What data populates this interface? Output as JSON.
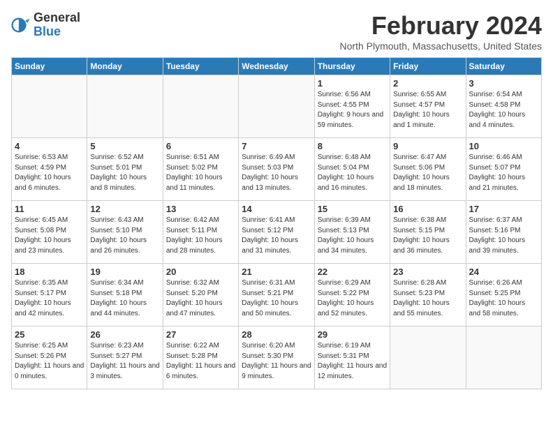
{
  "logo": {
    "line1": "General",
    "line2": "Blue"
  },
  "title": "February 2024",
  "subtitle": "North Plymouth, Massachusetts, United States",
  "days_of_week": [
    "Sunday",
    "Monday",
    "Tuesday",
    "Wednesday",
    "Thursday",
    "Friday",
    "Saturday"
  ],
  "weeks": [
    [
      {
        "day": "",
        "info": ""
      },
      {
        "day": "",
        "info": ""
      },
      {
        "day": "",
        "info": ""
      },
      {
        "day": "",
        "info": ""
      },
      {
        "day": "1",
        "info": "Sunrise: 6:56 AM\nSunset: 4:55 PM\nDaylight: 9 hours and 59 minutes."
      },
      {
        "day": "2",
        "info": "Sunrise: 6:55 AM\nSunset: 4:57 PM\nDaylight: 10 hours and 1 minute."
      },
      {
        "day": "3",
        "info": "Sunrise: 6:54 AM\nSunset: 4:58 PM\nDaylight: 10 hours and 4 minutes."
      }
    ],
    [
      {
        "day": "4",
        "info": "Sunrise: 6:53 AM\nSunset: 4:59 PM\nDaylight: 10 hours and 6 minutes."
      },
      {
        "day": "5",
        "info": "Sunrise: 6:52 AM\nSunset: 5:01 PM\nDaylight: 10 hours and 8 minutes."
      },
      {
        "day": "6",
        "info": "Sunrise: 6:51 AM\nSunset: 5:02 PM\nDaylight: 10 hours and 11 minutes."
      },
      {
        "day": "7",
        "info": "Sunrise: 6:49 AM\nSunset: 5:03 PM\nDaylight: 10 hours and 13 minutes."
      },
      {
        "day": "8",
        "info": "Sunrise: 6:48 AM\nSunset: 5:04 PM\nDaylight: 10 hours and 16 minutes."
      },
      {
        "day": "9",
        "info": "Sunrise: 6:47 AM\nSunset: 5:06 PM\nDaylight: 10 hours and 18 minutes."
      },
      {
        "day": "10",
        "info": "Sunrise: 6:46 AM\nSunset: 5:07 PM\nDaylight: 10 hours and 21 minutes."
      }
    ],
    [
      {
        "day": "11",
        "info": "Sunrise: 6:45 AM\nSunset: 5:08 PM\nDaylight: 10 hours and 23 minutes."
      },
      {
        "day": "12",
        "info": "Sunrise: 6:43 AM\nSunset: 5:10 PM\nDaylight: 10 hours and 26 minutes."
      },
      {
        "day": "13",
        "info": "Sunrise: 6:42 AM\nSunset: 5:11 PM\nDaylight: 10 hours and 28 minutes."
      },
      {
        "day": "14",
        "info": "Sunrise: 6:41 AM\nSunset: 5:12 PM\nDaylight: 10 hours and 31 minutes."
      },
      {
        "day": "15",
        "info": "Sunrise: 6:39 AM\nSunset: 5:13 PM\nDaylight: 10 hours and 34 minutes."
      },
      {
        "day": "16",
        "info": "Sunrise: 6:38 AM\nSunset: 5:15 PM\nDaylight: 10 hours and 36 minutes."
      },
      {
        "day": "17",
        "info": "Sunrise: 6:37 AM\nSunset: 5:16 PM\nDaylight: 10 hours and 39 minutes."
      }
    ],
    [
      {
        "day": "18",
        "info": "Sunrise: 6:35 AM\nSunset: 5:17 PM\nDaylight: 10 hours and 42 minutes."
      },
      {
        "day": "19",
        "info": "Sunrise: 6:34 AM\nSunset: 5:18 PM\nDaylight: 10 hours and 44 minutes."
      },
      {
        "day": "20",
        "info": "Sunrise: 6:32 AM\nSunset: 5:20 PM\nDaylight: 10 hours and 47 minutes."
      },
      {
        "day": "21",
        "info": "Sunrise: 6:31 AM\nSunset: 5:21 PM\nDaylight: 10 hours and 50 minutes."
      },
      {
        "day": "22",
        "info": "Sunrise: 6:29 AM\nSunset: 5:22 PM\nDaylight: 10 hours and 52 minutes."
      },
      {
        "day": "23",
        "info": "Sunrise: 6:28 AM\nSunset: 5:23 PM\nDaylight: 10 hours and 55 minutes."
      },
      {
        "day": "24",
        "info": "Sunrise: 6:26 AM\nSunset: 5:25 PM\nDaylight: 10 hours and 58 minutes."
      }
    ],
    [
      {
        "day": "25",
        "info": "Sunrise: 6:25 AM\nSunset: 5:26 PM\nDaylight: 11 hours and 0 minutes."
      },
      {
        "day": "26",
        "info": "Sunrise: 6:23 AM\nSunset: 5:27 PM\nDaylight: 11 hours and 3 minutes."
      },
      {
        "day": "27",
        "info": "Sunrise: 6:22 AM\nSunset: 5:28 PM\nDaylight: 11 hours and 6 minutes."
      },
      {
        "day": "28",
        "info": "Sunrise: 6:20 AM\nSunset: 5:30 PM\nDaylight: 11 hours and 9 minutes."
      },
      {
        "day": "29",
        "info": "Sunrise: 6:19 AM\nSunset: 5:31 PM\nDaylight: 11 hours and 12 minutes."
      },
      {
        "day": "",
        "info": ""
      },
      {
        "day": "",
        "info": ""
      }
    ]
  ]
}
